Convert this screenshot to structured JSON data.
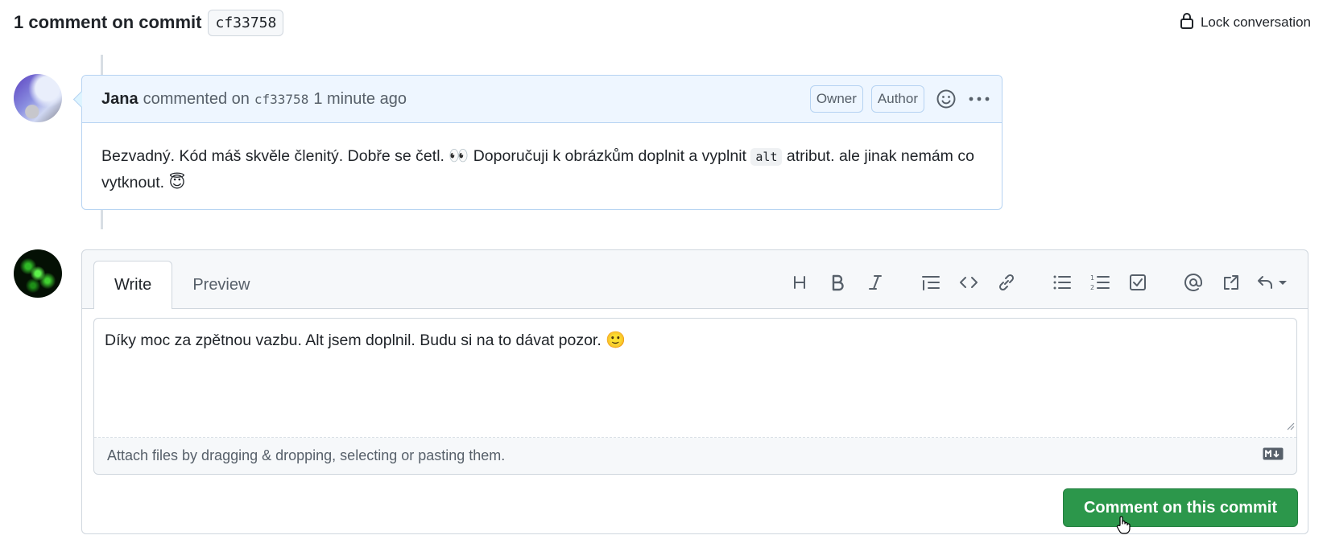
{
  "header": {
    "title": "1 comment on commit",
    "sha": "cf33758",
    "lock_label": "Lock conversation"
  },
  "comment": {
    "author": "Jana",
    "action": "commented on",
    "sha": "cf33758",
    "time": "1 minute ago",
    "badges": [
      "Owner",
      "Author"
    ],
    "body_part1": "Bezvadný. Kód máš skvěle členitý. Dobře se četl.",
    "emoji_eyes": "👀",
    "body_part2": "Doporučuji k obrázkům doplnit a vyplnit",
    "code": "alt",
    "body_part3": "atribut. ale jinak nemám co vytknout.",
    "emoji_halo": "😇"
  },
  "editor": {
    "tabs": [
      "Write",
      "Preview"
    ],
    "active_tab": "Write",
    "text": "Díky moc za zpětnou vazbu. Alt jsem doplnil. Budu si na to dávat pozor.",
    "text_emoji": "🙂",
    "attach_hint": "Attach files by dragging & dropping, selecting or pasting them.",
    "submit_label": "Comment on this commit",
    "toolbar_icons": [
      "heading-icon",
      "bold-icon",
      "italic-icon",
      "quote-icon",
      "code-icon",
      "link-icon",
      "unordered-list-icon",
      "ordered-list-icon",
      "task-list-icon",
      "mention-icon",
      "cross-reference-icon",
      "saved-replies-icon"
    ]
  },
  "colors": {
    "accent_green": "#2c974b",
    "comment_header_bg": "#eef6ff",
    "comment_border": "#b6d3f2"
  }
}
